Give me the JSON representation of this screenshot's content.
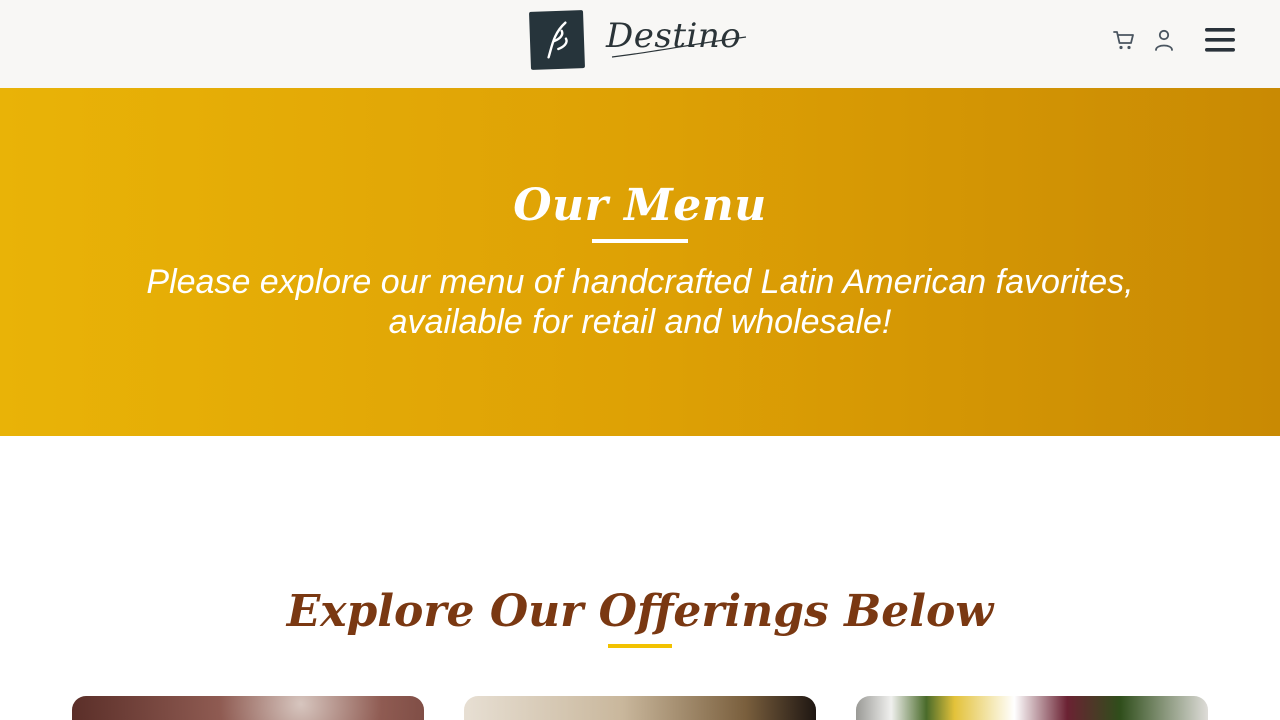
{
  "header": {
    "brand_name": "Destino",
    "icons": {
      "logo": "brand-logo-icon",
      "cart": "cart-icon",
      "account": "user-icon",
      "menu": "hamburger-menu-icon"
    }
  },
  "hero": {
    "title": "Our Menu",
    "subtitle": "Please explore our menu of handcrafted Latin American favorites, available for retail and wholesale!",
    "colors": {
      "gradient_start": "#e9b307",
      "gradient_end": "#c98a03"
    }
  },
  "offerings": {
    "title": "Explore Our Offerings Below",
    "accent": "#f2c200",
    "title_color": "#7a3812",
    "cards": [
      {
        "image": "chocolate-dessert-photo"
      },
      {
        "image": "empanadas-photo"
      },
      {
        "image": "salad-plates-photo"
      }
    ]
  }
}
